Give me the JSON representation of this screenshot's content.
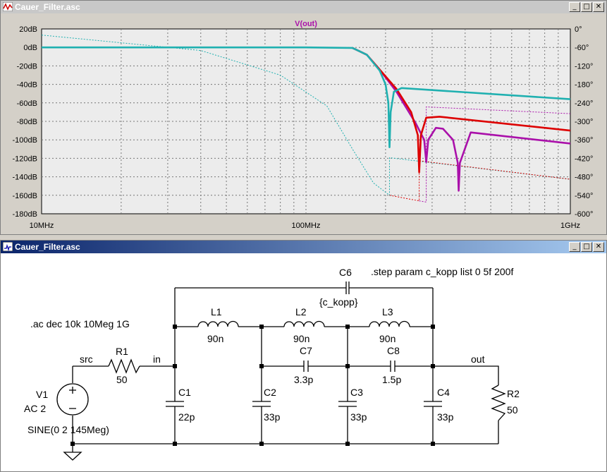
{
  "plot_window": {
    "title": "Cauer_Filter.asc",
    "trace_label": "V(out)",
    "controls": {
      "minimize": "_",
      "maximize": "□",
      "close": "✕"
    }
  },
  "chart_data": {
    "type": "line",
    "title": "V(out)",
    "x_scale": "log",
    "xlim_hz": [
      10000000,
      1000000000
    ],
    "x_ticks": [
      {
        "value": 10000000,
        "label": "10MHz"
      },
      {
        "value": 100000000,
        "label": "100MHz"
      },
      {
        "value": 1000000000,
        "label": "1GHz"
      }
    ],
    "left_axis": {
      "unit": "dB",
      "ylim": [
        -180,
        20
      ],
      "ticks": [
        "20dB",
        "0dB",
        "-20dB",
        "-40dB",
        "-60dB",
        "-80dB",
        "-100dB",
        "-120dB",
        "-140dB",
        "-160dB",
        "-180dB"
      ]
    },
    "right_axis": {
      "unit": "deg",
      "ylim": [
        -600,
        0
      ],
      "ticks": [
        "0°",
        "-60°",
        "-120°",
        "-180°",
        "-240°",
        "-300°",
        "-360°",
        "-420°",
        "-480°",
        "-540°",
        "-600°"
      ]
    },
    "grid": true,
    "colors": {
      "c_kopp_0": "#1fb0b0",
      "c_kopp_5f": "#dd0000",
      "c_kopp_200f": "#aa10aa"
    },
    "magnitude_db": {
      "c_kopp_0": [
        [
          10000000,
          0
        ],
        [
          100000000,
          0
        ],
        [
          150000000,
          -0.5
        ],
        [
          170000000,
          -8
        ],
        [
          190000000,
          -25
        ],
        [
          200000000,
          -40
        ],
        [
          205000000,
          -60
        ],
        [
          207000000,
          -108
        ],
        [
          209000000,
          -70
        ],
        [
          215000000,
          -48
        ],
        [
          230000000,
          -44
        ],
        [
          1000000000,
          -56
        ]
      ],
      "c_kopp_5f": [
        [
          150000000,
          -0.5
        ],
        [
          170000000,
          -8
        ],
        [
          190000000,
          -24
        ],
        [
          220000000,
          -45
        ],
        [
          250000000,
          -70
        ],
        [
          265000000,
          -95
        ],
        [
          268000000,
          -135
        ],
        [
          272000000,
          -95
        ],
        [
          285000000,
          -76
        ],
        [
          320000000,
          -75
        ],
        [
          1000000000,
          -90
        ]
      ],
      "c_kopp_200f": [
        [
          150000000,
          -0.5
        ],
        [
          170000000,
          -8
        ],
        [
          190000000,
          -24
        ],
        [
          220000000,
          -48
        ],
        [
          260000000,
          -82
        ],
        [
          280000000,
          -100
        ],
        [
          285000000,
          -124
        ],
        [
          290000000,
          -100
        ],
        [
          310000000,
          -87
        ],
        [
          330000000,
          -88
        ],
        [
          360000000,
          -100
        ],
        [
          375000000,
          -125
        ],
        [
          378000000,
          -155
        ],
        [
          382000000,
          -125
        ],
        [
          420000000,
          -92
        ],
        [
          1000000000,
          -104
        ]
      ]
    },
    "phase_deg": {
      "c_kopp_0": [
        [
          10000000,
          -20
        ],
        [
          40000000,
          -70
        ],
        [
          80000000,
          -150
        ],
        [
          120000000,
          -250
        ],
        [
          150000000,
          -390
        ],
        [
          180000000,
          -500
        ],
        [
          207000000,
          -540
        ],
        [
          207000000,
          -418
        ],
        [
          1000000000,
          -488
        ]
      ],
      "c_kopp_5f": [
        [
          207000000,
          -540
        ],
        [
          268000000,
          -558
        ],
        [
          268000000,
          -428
        ],
        [
          1000000000,
          -488
        ]
      ],
      "c_kopp_200f": [
        [
          268000000,
          -558
        ],
        [
          285000000,
          -562
        ],
        [
          285000000,
          -253
        ],
        [
          1000000000,
          -275
        ]
      ]
    }
  },
  "schematic_window": {
    "title": "Cauer_Filter.asc",
    "controls": {
      "minimize": "_",
      "maximize": "□",
      "close": "✕"
    },
    "directives": {
      "step": ".step param c_kopp list 0 5f 200f",
      "ac": ".ac dec 10k 10Meg 1G"
    },
    "nets": {
      "src": "src",
      "in": "in",
      "out": "out"
    },
    "components": {
      "V1": {
        "name": "V1",
        "value": "AC 2",
        "extra": "SINE(0 2 145Meg)"
      },
      "R1": {
        "name": "R1",
        "value": "50"
      },
      "R2": {
        "name": "R2",
        "value": "50"
      },
      "L1": {
        "name": "L1",
        "value": "90n"
      },
      "L2": {
        "name": "L2",
        "value": "90n"
      },
      "L3": {
        "name": "L3",
        "value": "90n"
      },
      "C1": {
        "name": "C1",
        "value": "22p"
      },
      "C2": {
        "name": "C2",
        "value": "33p"
      },
      "C3": {
        "name": "C3",
        "value": "33p"
      },
      "C4": {
        "name": "C4",
        "value": "33p"
      },
      "C6": {
        "name": "C6",
        "value": "{c_kopp}"
      },
      "C7": {
        "name": "C7",
        "value": "3.3p"
      },
      "C8": {
        "name": "C8",
        "value": "1.5p"
      }
    }
  }
}
